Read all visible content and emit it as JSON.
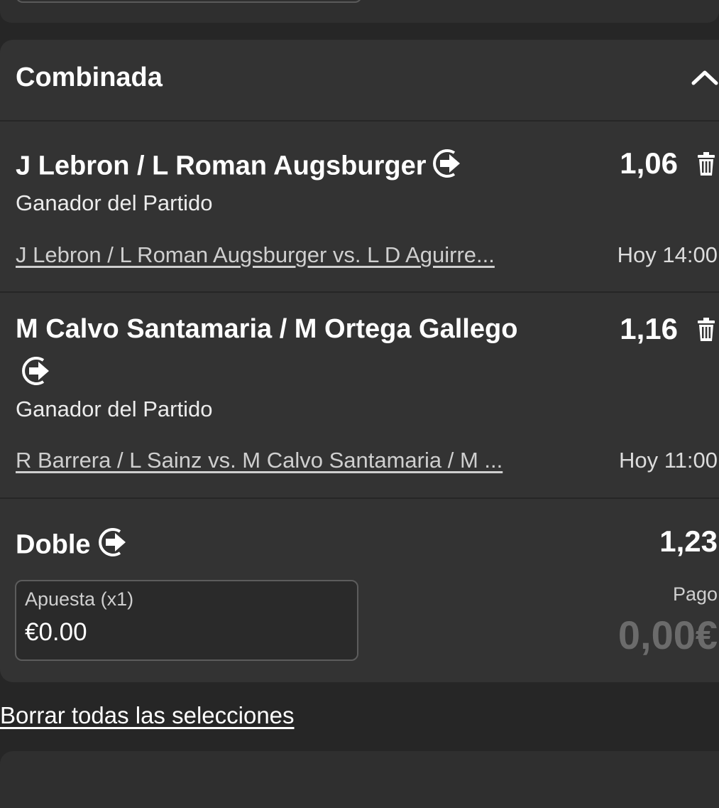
{
  "section": {
    "title": "Combinada"
  },
  "selections": [
    {
      "name": "J Lebron / L Roman Augsburger",
      "odds": "1,06",
      "market": "Ganador del Partido",
      "event": "J Lebron / L Roman Augsburger vs. L D Aguirre...",
      "time": "Hoy 14:00"
    },
    {
      "name": "M Calvo Santamaria / M Ortega Gallego",
      "odds": "1,16",
      "market": "Ganador del Partido",
      "event": "R Barrera / L Sainz vs. M Calvo Santamaria / M ...",
      "time": "Hoy 11:00"
    }
  ],
  "bet": {
    "type_label": "Doble",
    "odds": "1,23",
    "stake_label": "Apuesta (x1)",
    "stake_value": "€0.00",
    "payout_label": "Pago",
    "payout_value": "0,00€"
  },
  "actions": {
    "clear_all": "Borrar todas las selecciones"
  },
  "icons": {
    "collapse": "chevron-up-icon",
    "cashout": "cashout-arrow-icon",
    "remove": "trash-icon"
  },
  "colors": {
    "background": "#262626",
    "card": "#333333",
    "payout_muted": "#6b6b6b"
  }
}
